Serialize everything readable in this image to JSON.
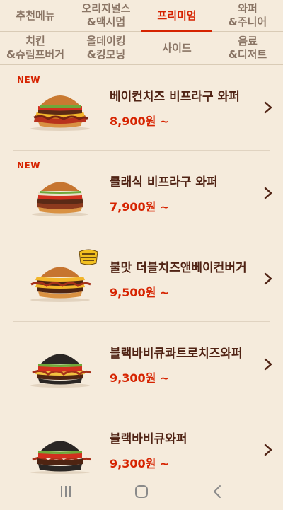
{
  "tabs": {
    "row1": [
      {
        "label": "추천메뉴",
        "active": false
      },
      {
        "label": "오리지널스\n&맥시멈",
        "active": false
      },
      {
        "label": "프리미엄",
        "active": true
      },
      {
        "label": "와퍼\n&주니어",
        "active": false
      }
    ],
    "row2": [
      {
        "label": "치킨\n&슈림프버거"
      },
      {
        "label": "올데이킹\n&킹모닝"
      },
      {
        "label": "사이드"
      },
      {
        "label": "음료\n&디저트"
      }
    ]
  },
  "menu": [
    {
      "badge": "NEW",
      "name": "베이컨치즈 비프라구 와퍼",
      "price": "8,900원 ~"
    },
    {
      "badge": "NEW",
      "name": "클래식 비프라구 와퍼",
      "price": "7,900원 ~"
    },
    {
      "badge": "",
      "name": "불맛 더블치즈앤베이컨버거",
      "price": "9,500원 ~"
    },
    {
      "badge": "",
      "name": "블랙바비큐콰트로치즈와퍼",
      "price": "9,300원 ~"
    },
    {
      "badge": "",
      "name": "블랙바비큐와퍼",
      "price": "9,300원 ~"
    }
  ],
  "colors": {
    "accent": "#d62300",
    "background": "#f5ebdc",
    "text": "#502314"
  },
  "icons": {
    "chevron": "chevron-right-icon",
    "recent": "recent-apps-icon",
    "home": "home-icon",
    "back": "back-icon"
  }
}
